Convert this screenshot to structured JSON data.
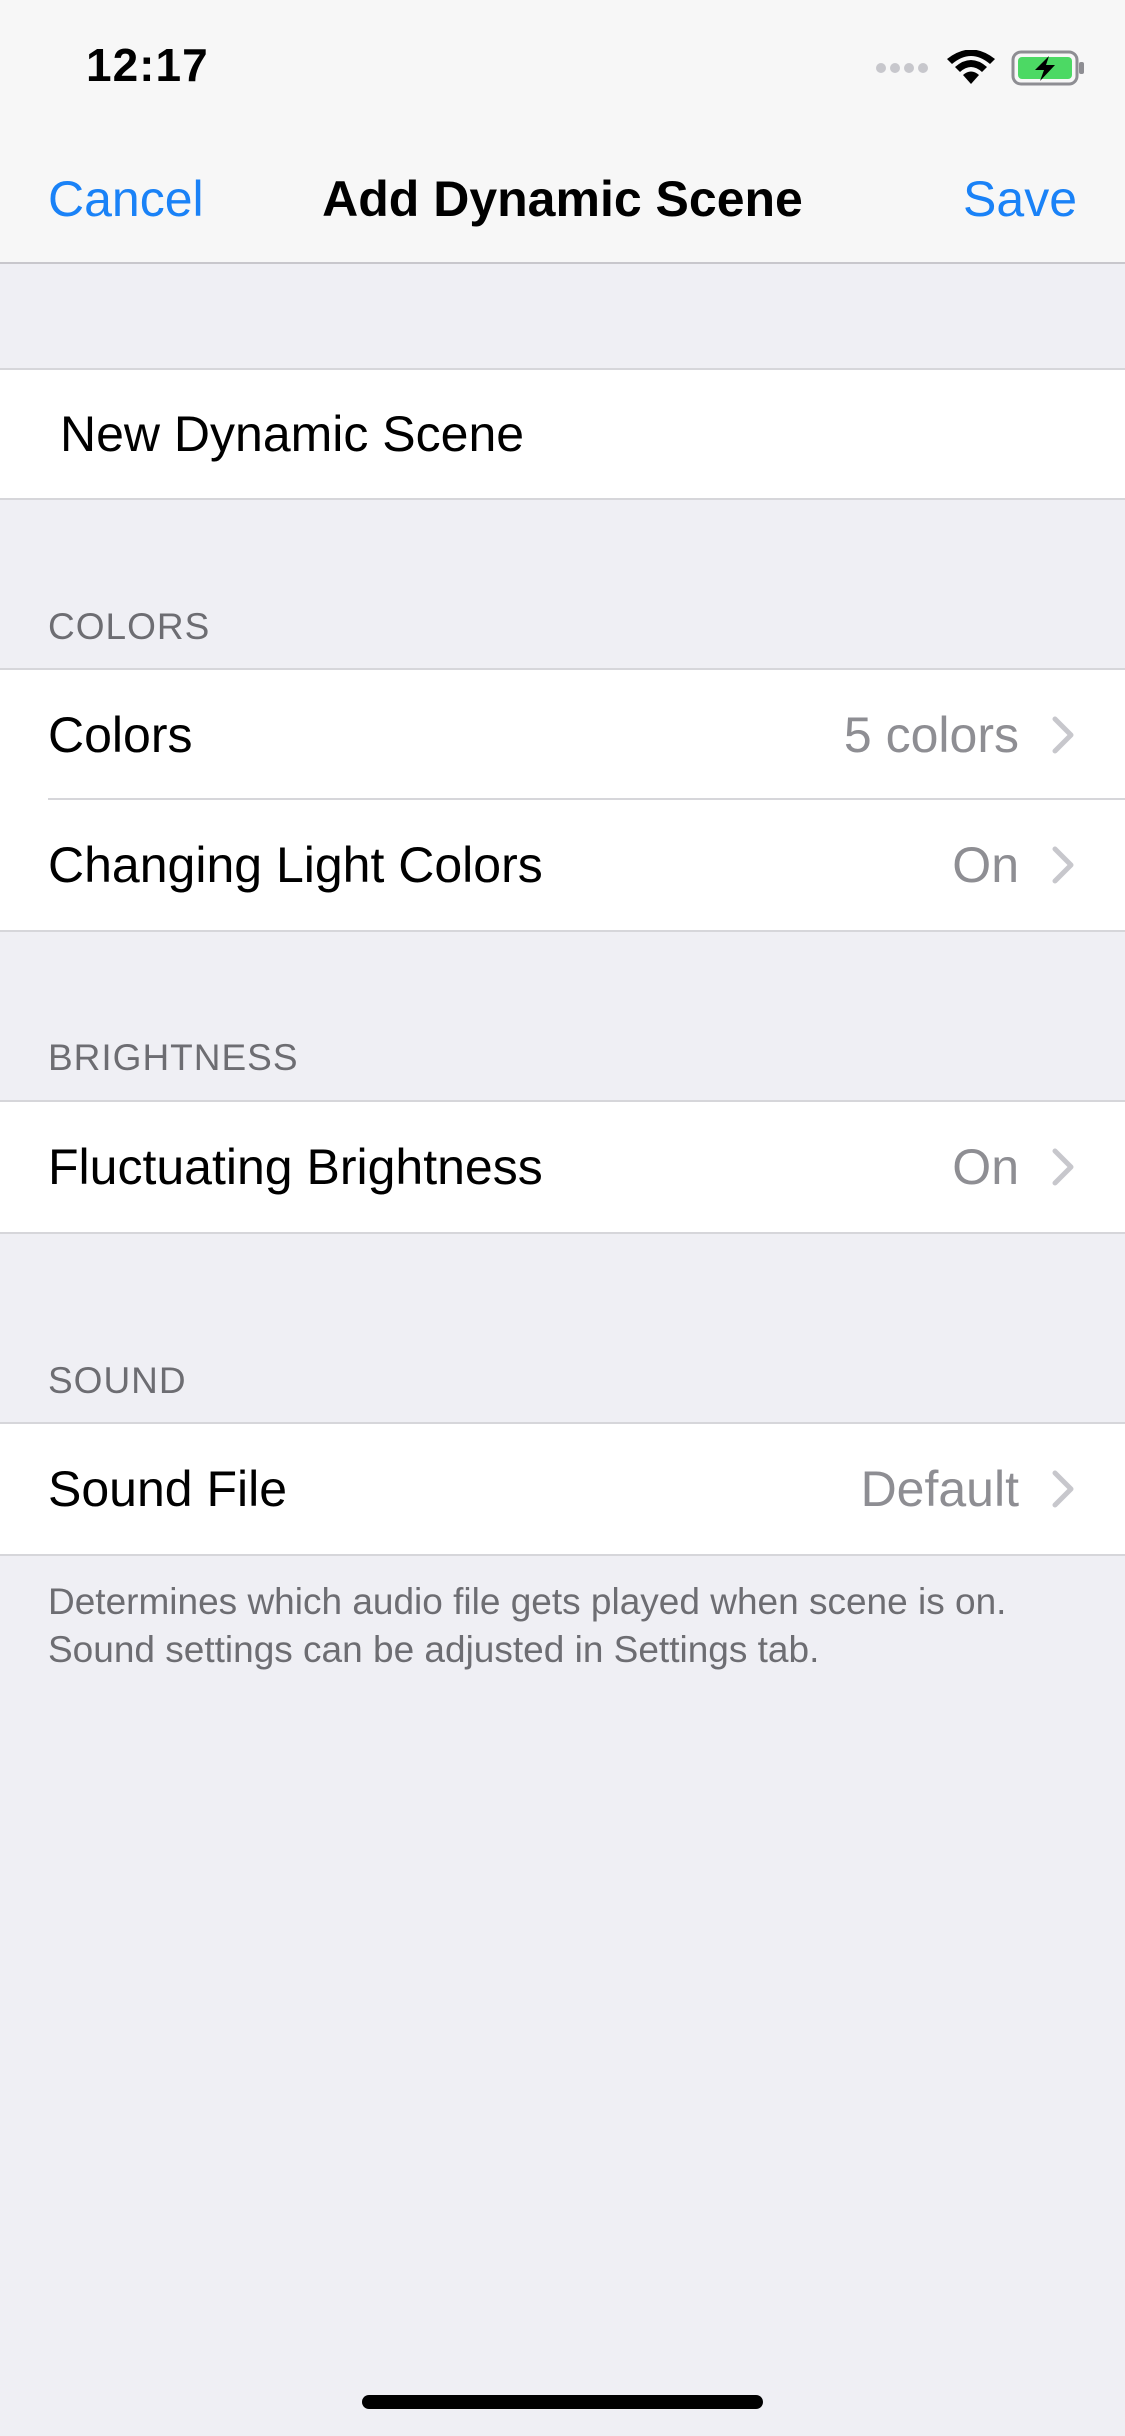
{
  "status_bar": {
    "time": "12:17",
    "icons": [
      "signal-dots-icon",
      "wifi-icon",
      "battery-charging-icon"
    ]
  },
  "nav": {
    "cancel_label": "Cancel",
    "title": "Add Dynamic Scene",
    "save_label": "Save"
  },
  "name_field": {
    "value": "New Dynamic Scene"
  },
  "sections": {
    "colors": {
      "header": "COLORS",
      "rows": [
        {
          "label": "Colors",
          "value": "5 colors"
        },
        {
          "label": "Changing Light Colors",
          "value": "On"
        }
      ]
    },
    "brightness": {
      "header": "BRIGHTNESS",
      "rows": [
        {
          "label": "Fluctuating Brightness",
          "value": "On"
        }
      ]
    },
    "sound": {
      "header": "SOUND",
      "rows": [
        {
          "label": "Sound File",
          "value": "Default"
        }
      ],
      "footer": "Determines which audio file gets played when scene is on.  Sound settings can be adjusted in Settings tab."
    }
  },
  "colors": {
    "accent": "#1a82f7",
    "background": "#efeff4",
    "secondary_text": "#8e8e93",
    "battery_fill": "#4cd964"
  }
}
